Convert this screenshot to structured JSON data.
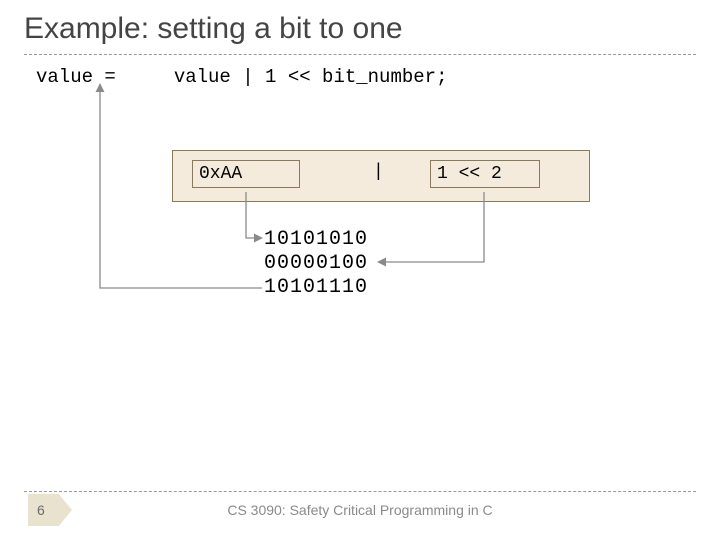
{
  "title": "Example: setting a bit to one",
  "code": {
    "lhs": "value =",
    "rhs": "value | 1 << bit_number;"
  },
  "boxes": {
    "left": "0xAA",
    "pipe": "|",
    "right": "1 << 2"
  },
  "bits": {
    "row1": "10101010",
    "row2": "00000100",
    "row3": "10101110"
  },
  "footer": {
    "course": "CS 3090: Safety Critical Programming in C",
    "page": "6"
  }
}
